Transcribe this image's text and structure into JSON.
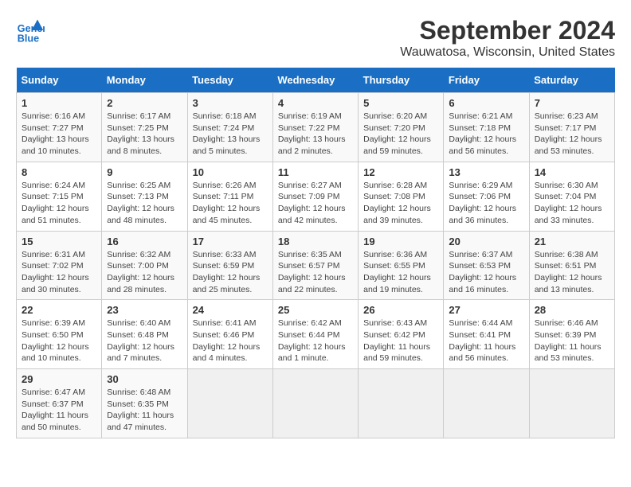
{
  "header": {
    "logo_line1": "General",
    "logo_line2": "Blue",
    "title": "September 2024",
    "subtitle": "Wauwatosa, Wisconsin, United States"
  },
  "days_of_week": [
    "Sunday",
    "Monday",
    "Tuesday",
    "Wednesday",
    "Thursday",
    "Friday",
    "Saturday"
  ],
  "weeks": [
    [
      {
        "num": "1",
        "sunrise": "6:16 AM",
        "sunset": "7:27 PM",
        "daylight": "13 hours and 10 minutes."
      },
      {
        "num": "2",
        "sunrise": "6:17 AM",
        "sunset": "7:25 PM",
        "daylight": "13 hours and 8 minutes."
      },
      {
        "num": "3",
        "sunrise": "6:18 AM",
        "sunset": "7:24 PM",
        "daylight": "13 hours and 5 minutes."
      },
      {
        "num": "4",
        "sunrise": "6:19 AM",
        "sunset": "7:22 PM",
        "daylight": "13 hours and 2 minutes."
      },
      {
        "num": "5",
        "sunrise": "6:20 AM",
        "sunset": "7:20 PM",
        "daylight": "12 hours and 59 minutes."
      },
      {
        "num": "6",
        "sunrise": "6:21 AM",
        "sunset": "7:18 PM",
        "daylight": "12 hours and 56 minutes."
      },
      {
        "num": "7",
        "sunrise": "6:23 AM",
        "sunset": "7:17 PM",
        "daylight": "12 hours and 53 minutes."
      }
    ],
    [
      {
        "num": "8",
        "sunrise": "6:24 AM",
        "sunset": "7:15 PM",
        "daylight": "12 hours and 51 minutes."
      },
      {
        "num": "9",
        "sunrise": "6:25 AM",
        "sunset": "7:13 PM",
        "daylight": "12 hours and 48 minutes."
      },
      {
        "num": "10",
        "sunrise": "6:26 AM",
        "sunset": "7:11 PM",
        "daylight": "12 hours and 45 minutes."
      },
      {
        "num": "11",
        "sunrise": "6:27 AM",
        "sunset": "7:09 PM",
        "daylight": "12 hours and 42 minutes."
      },
      {
        "num": "12",
        "sunrise": "6:28 AM",
        "sunset": "7:08 PM",
        "daylight": "12 hours and 39 minutes."
      },
      {
        "num": "13",
        "sunrise": "6:29 AM",
        "sunset": "7:06 PM",
        "daylight": "12 hours and 36 minutes."
      },
      {
        "num": "14",
        "sunrise": "6:30 AM",
        "sunset": "7:04 PM",
        "daylight": "12 hours and 33 minutes."
      }
    ],
    [
      {
        "num": "15",
        "sunrise": "6:31 AM",
        "sunset": "7:02 PM",
        "daylight": "12 hours and 30 minutes."
      },
      {
        "num": "16",
        "sunrise": "6:32 AM",
        "sunset": "7:00 PM",
        "daylight": "12 hours and 28 minutes."
      },
      {
        "num": "17",
        "sunrise": "6:33 AM",
        "sunset": "6:59 PM",
        "daylight": "12 hours and 25 minutes."
      },
      {
        "num": "18",
        "sunrise": "6:35 AM",
        "sunset": "6:57 PM",
        "daylight": "12 hours and 22 minutes."
      },
      {
        "num": "19",
        "sunrise": "6:36 AM",
        "sunset": "6:55 PM",
        "daylight": "12 hours and 19 minutes."
      },
      {
        "num": "20",
        "sunrise": "6:37 AM",
        "sunset": "6:53 PM",
        "daylight": "12 hours and 16 minutes."
      },
      {
        "num": "21",
        "sunrise": "6:38 AM",
        "sunset": "6:51 PM",
        "daylight": "12 hours and 13 minutes."
      }
    ],
    [
      {
        "num": "22",
        "sunrise": "6:39 AM",
        "sunset": "6:50 PM",
        "daylight": "12 hours and 10 minutes."
      },
      {
        "num": "23",
        "sunrise": "6:40 AM",
        "sunset": "6:48 PM",
        "daylight": "12 hours and 7 minutes."
      },
      {
        "num": "24",
        "sunrise": "6:41 AM",
        "sunset": "6:46 PM",
        "daylight": "12 hours and 4 minutes."
      },
      {
        "num": "25",
        "sunrise": "6:42 AM",
        "sunset": "6:44 PM",
        "daylight": "12 hours and 1 minute."
      },
      {
        "num": "26",
        "sunrise": "6:43 AM",
        "sunset": "6:42 PM",
        "daylight": "11 hours and 59 minutes."
      },
      {
        "num": "27",
        "sunrise": "6:44 AM",
        "sunset": "6:41 PM",
        "daylight": "11 hours and 56 minutes."
      },
      {
        "num": "28",
        "sunrise": "6:46 AM",
        "sunset": "6:39 PM",
        "daylight": "11 hours and 53 minutes."
      }
    ],
    [
      {
        "num": "29",
        "sunrise": "6:47 AM",
        "sunset": "6:37 PM",
        "daylight": "11 hours and 50 minutes."
      },
      {
        "num": "30",
        "sunrise": "6:48 AM",
        "sunset": "6:35 PM",
        "daylight": "11 hours and 47 minutes."
      },
      null,
      null,
      null,
      null,
      null
    ]
  ]
}
